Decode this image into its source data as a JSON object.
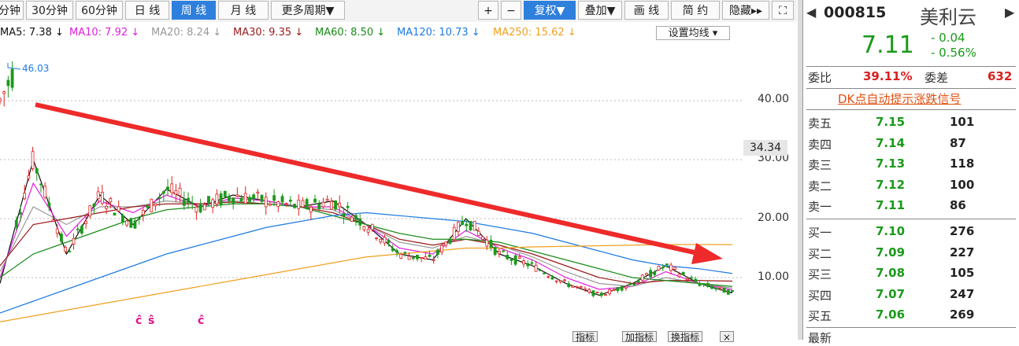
{
  "toolbar": {
    "periods": [
      "分钟",
      "30分钟",
      "60分钟",
      "日 线",
      "周 线",
      "月 线",
      "更多周期▼"
    ],
    "active_period": "周 线",
    "tools": [
      "+",
      "−",
      "复权▼",
      "叠加▼",
      "画 线",
      "简 约",
      "隐藏▸▸",
      "⛶"
    ]
  },
  "ma_legend": [
    {
      "label": "MA5: 7.38 ↓",
      "color": "#111111"
    },
    {
      "label": "MA10: 7.92 ↓",
      "color": "#e020e0"
    },
    {
      "label": "MA20: 8.24 ↓",
      "color": "#999999"
    },
    {
      "label": "MA30: 9.35 ↓",
      "color": "#9b1b1b"
    },
    {
      "label": "MA60: 8.50 ↓",
      "color": "#1a8c1a"
    },
    {
      "label": "MA120: 10.73 ↓",
      "color": "#1e7be0"
    },
    {
      "label": "MA250: 15.62 ↓",
      "color": "#f0a020"
    }
  ],
  "set_ma_label": "设置均线 ▾",
  "chart_data": {
    "type": "candlestick",
    "y_ticks": [
      "40.00",
      "30.00",
      "20.00",
      "10.00"
    ],
    "y_tick_values": [
      40,
      30,
      20,
      10
    ],
    "ylim": [
      2,
      49
    ],
    "peak_label": "46.03",
    "current_price_tag": "34.34",
    "trend_arrow": "downward red arrow from high to low",
    "series": [
      {
        "name": "MA5",
        "values": [
          9,
          30,
          14,
          24,
          19,
          25,
          22,
          24,
          23,
          22,
          23,
          19,
          14,
          13,
          20,
          14,
          12,
          9,
          7,
          9,
          12,
          9,
          7.4
        ]
      },
      {
        "name": "MA10",
        "values": [
          10,
          26,
          17,
          23,
          21,
          24,
          22,
          23.5,
          23,
          22,
          22,
          19,
          15,
          14,
          18,
          15,
          13,
          10,
          8,
          8.5,
          11,
          9,
          7.9
        ]
      },
      {
        "name": "MA20",
        "values": [
          11,
          22,
          19,
          22,
          22,
          23,
          22.5,
          23,
          22.5,
          22,
          21.5,
          19,
          16,
          15,
          17,
          15.5,
          13.5,
          11,
          9,
          8.5,
          10,
          9,
          8.2
        ]
      },
      {
        "name": "MA30",
        "values": [
          12,
          19,
          20,
          21,
          22,
          22.5,
          22.5,
          22.8,
          22.5,
          22,
          21,
          19,
          16.5,
          15.5,
          16.5,
          15.5,
          14,
          12,
          10,
          9,
          9.5,
          9.5,
          9.4
        ]
      },
      {
        "name": "MA60",
        "values": [
          10,
          14,
          16,
          18,
          20,
          21.5,
          22,
          22.5,
          22.5,
          22,
          20.5,
          19,
          17.5,
          16.5,
          16.5,
          16,
          14.5,
          13,
          11.5,
          10,
          9.5,
          9,
          8.5
        ]
      },
      {
        "name": "MA120",
        "values": [
          4,
          6,
          8,
          10,
          12,
          14,
          15.5,
          17,
          18.5,
          19.5,
          20.5,
          21,
          20.5,
          20,
          19.5,
          18.5,
          17.5,
          16,
          14.5,
          13,
          12,
          11.5,
          10.7
        ]
      },
      {
        "name": "MA250",
        "values": [
          2.5,
          3.5,
          4.5,
          5.5,
          6.5,
          7.5,
          8.5,
          9.5,
          10.5,
          11.5,
          12.5,
          13.5,
          14,
          14.5,
          15,
          15,
          15.2,
          15.3,
          15.4,
          15.5,
          15.6,
          15.6,
          15.6
        ]
      }
    ],
    "markers": [
      "ĉ",
      "ŝ",
      "ĉ"
    ]
  },
  "panel": {
    "code": "000815",
    "name": "美利云",
    "price": "7.11",
    "change": "- 0.04",
    "change_pct": "- 0.56%",
    "weibi_label": "委比",
    "weibi_value": "39.11%",
    "weicha_label": "委差",
    "weicha_value": "632",
    "dk_link": "DK点自动提示涨跌信号",
    "sells": [
      {
        "label": "卖五",
        "price": "7.15",
        "vol": "101"
      },
      {
        "label": "卖四",
        "price": "7.14",
        "vol": "87"
      },
      {
        "label": "卖三",
        "price": "7.13",
        "vol": "118"
      },
      {
        "label": "卖二",
        "price": "7.12",
        "vol": "100"
      },
      {
        "label": "卖一",
        "price": "7.11",
        "vol": "86"
      }
    ],
    "buys": [
      {
        "label": "买一",
        "price": "7.10",
        "vol": "276"
      },
      {
        "label": "买二",
        "price": "7.09",
        "vol": "227"
      },
      {
        "label": "买三",
        "price": "7.08",
        "vol": "105"
      },
      {
        "label": "买四",
        "price": "7.07",
        "vol": "247"
      },
      {
        "label": "买五",
        "price": "7.06",
        "vol": "269"
      }
    ],
    "bottom_label": "最新"
  },
  "colors": {
    "up": "#e02020",
    "down": "#1a9a1a",
    "active": "#2f7fdc"
  }
}
